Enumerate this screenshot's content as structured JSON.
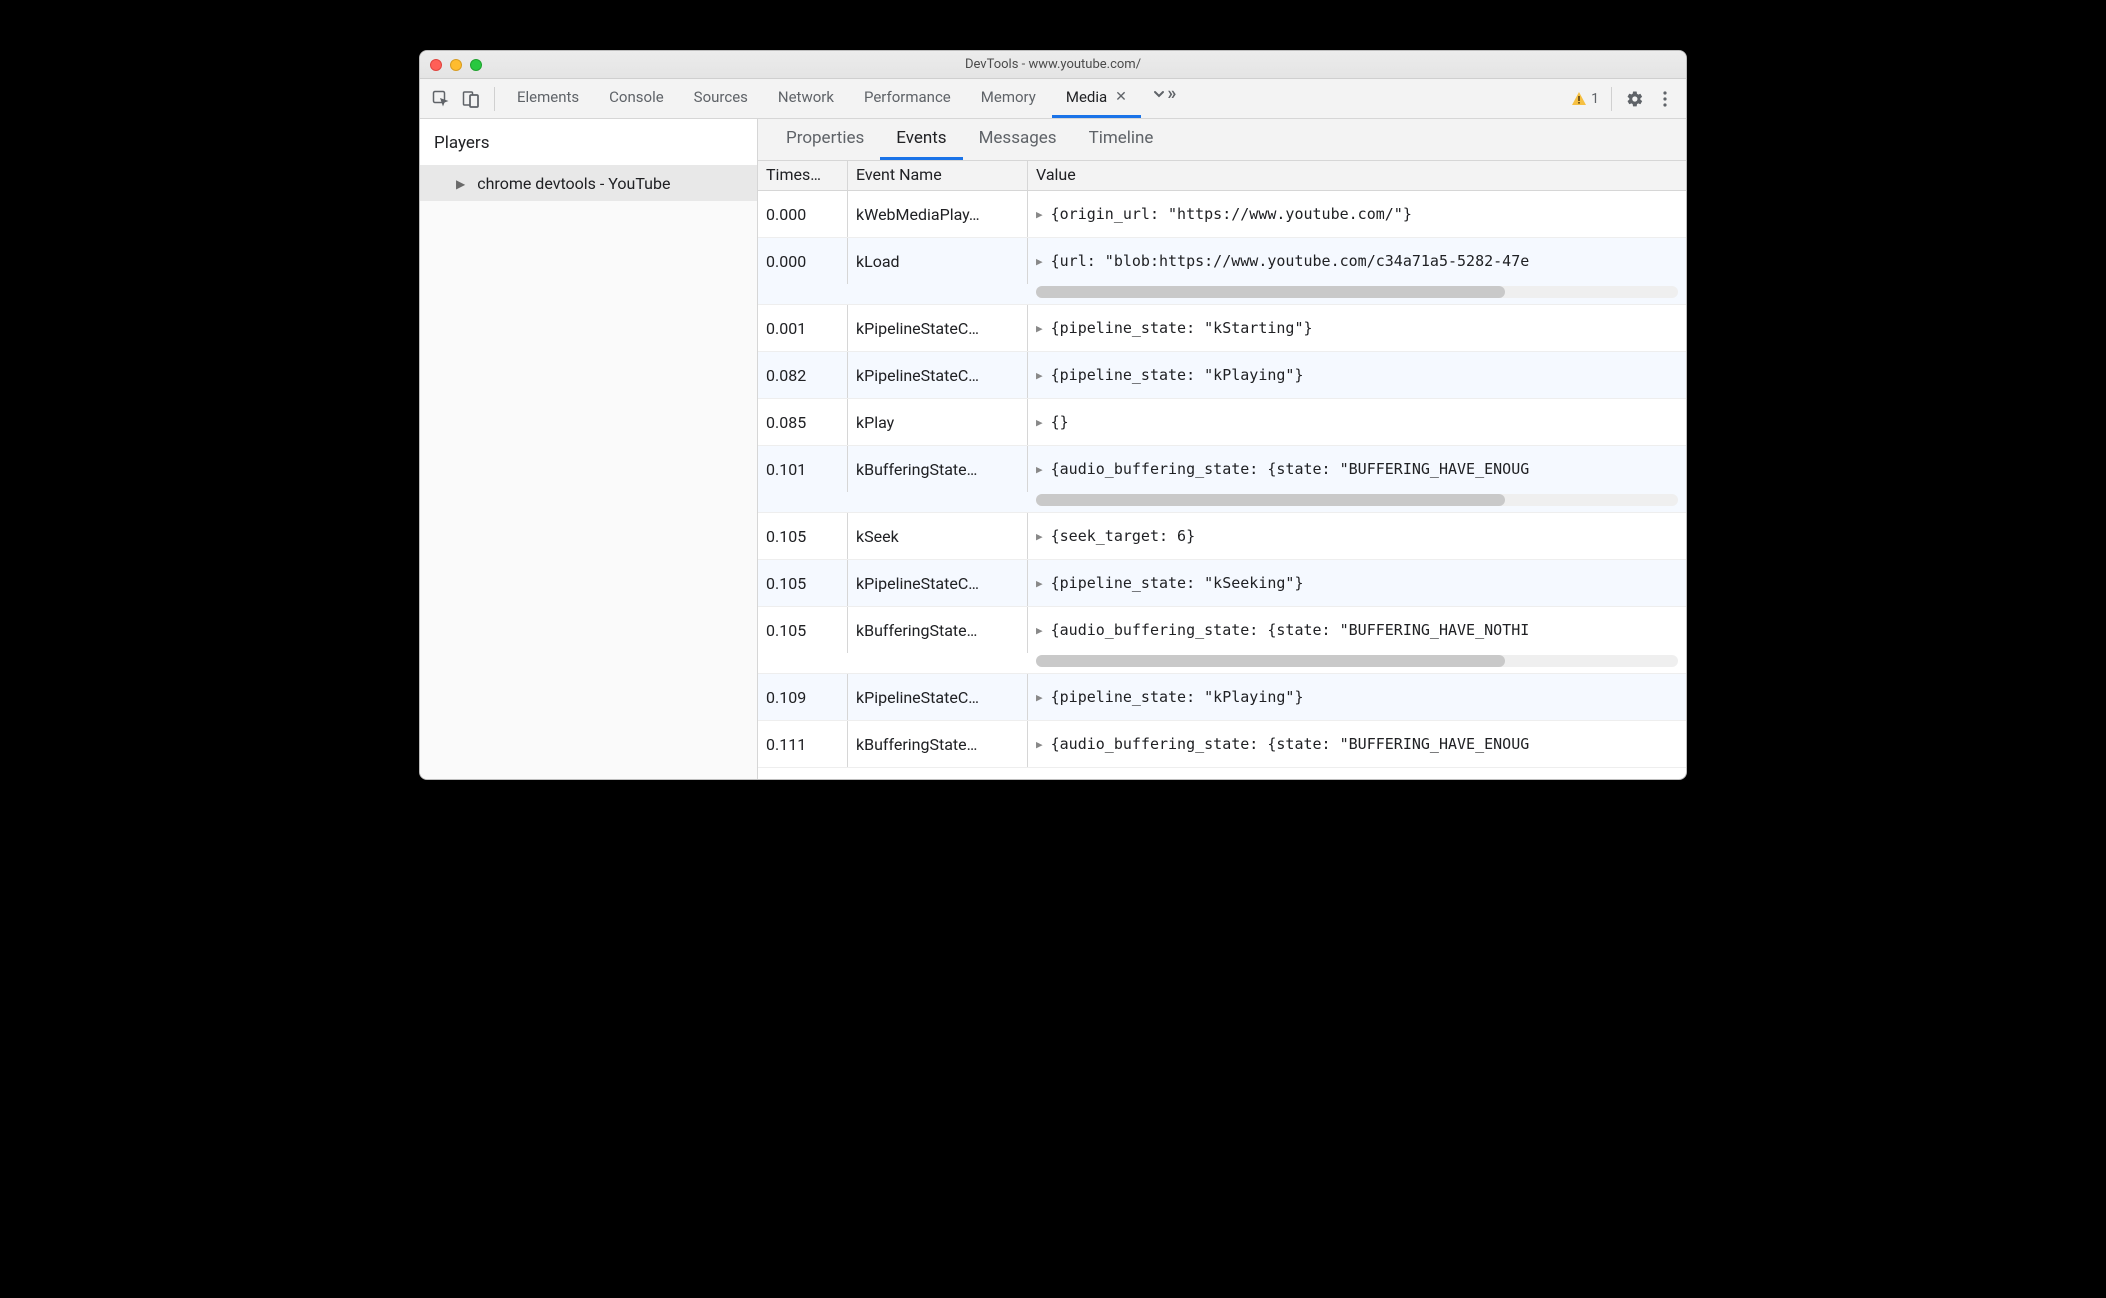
{
  "window": {
    "title": "DevTools - www.youtube.com/"
  },
  "toolbar": {
    "tabs": [
      "Elements",
      "Console",
      "Sources",
      "Network",
      "Performance",
      "Memory",
      "Media"
    ],
    "active_tab": "Media",
    "warning_count": "1"
  },
  "sidebar": {
    "title": "Players",
    "player_label": "chrome devtools - YouTube"
  },
  "subtabs": {
    "items": [
      "Properties",
      "Events",
      "Messages",
      "Timeline"
    ],
    "active": "Events"
  },
  "columns": {
    "ts": "Times…",
    "event": "Event Name",
    "value": "Value"
  },
  "rows": [
    {
      "ts": "0.000",
      "event": "kWebMediaPlay…",
      "value": "{origin_url: \"https://www.youtube.com/\"}",
      "overflow_bar": false
    },
    {
      "ts": "0.000",
      "event": "kLoad",
      "value": "{url: \"blob:https://www.youtube.com/c34a71a5-5282-47e",
      "overflow_bar": true
    },
    {
      "ts": "0.001",
      "event": "kPipelineStateC…",
      "value": "{pipeline_state: \"kStarting\"}",
      "overflow_bar": false
    },
    {
      "ts": "0.082",
      "event": "kPipelineStateC…",
      "value": "{pipeline_state: \"kPlaying\"}",
      "overflow_bar": false
    },
    {
      "ts": "0.085",
      "event": "kPlay",
      "value": "{}",
      "overflow_bar": false
    },
    {
      "ts": "0.101",
      "event": "kBufferingState…",
      "value": "{audio_buffering_state: {state: \"BUFFERING_HAVE_ENOUG",
      "overflow_bar": true
    },
    {
      "ts": "0.105",
      "event": "kSeek",
      "value": "{seek_target: 6}",
      "overflow_bar": false
    },
    {
      "ts": "0.105",
      "event": "kPipelineStateC…",
      "value": "{pipeline_state: \"kSeeking\"}",
      "overflow_bar": false
    },
    {
      "ts": "0.105",
      "event": "kBufferingState…",
      "value": "{audio_buffering_state: {state: \"BUFFERING_HAVE_NOTHI",
      "overflow_bar": true
    },
    {
      "ts": "0.109",
      "event": "kPipelineStateC…",
      "value": "{pipeline_state: \"kPlaying\"}",
      "overflow_bar": false
    },
    {
      "ts": "0.111",
      "event": "kBufferingState…",
      "value": "{audio_buffering_state: {state: \"BUFFERING_HAVE_ENOUG",
      "overflow_bar": false
    }
  ]
}
